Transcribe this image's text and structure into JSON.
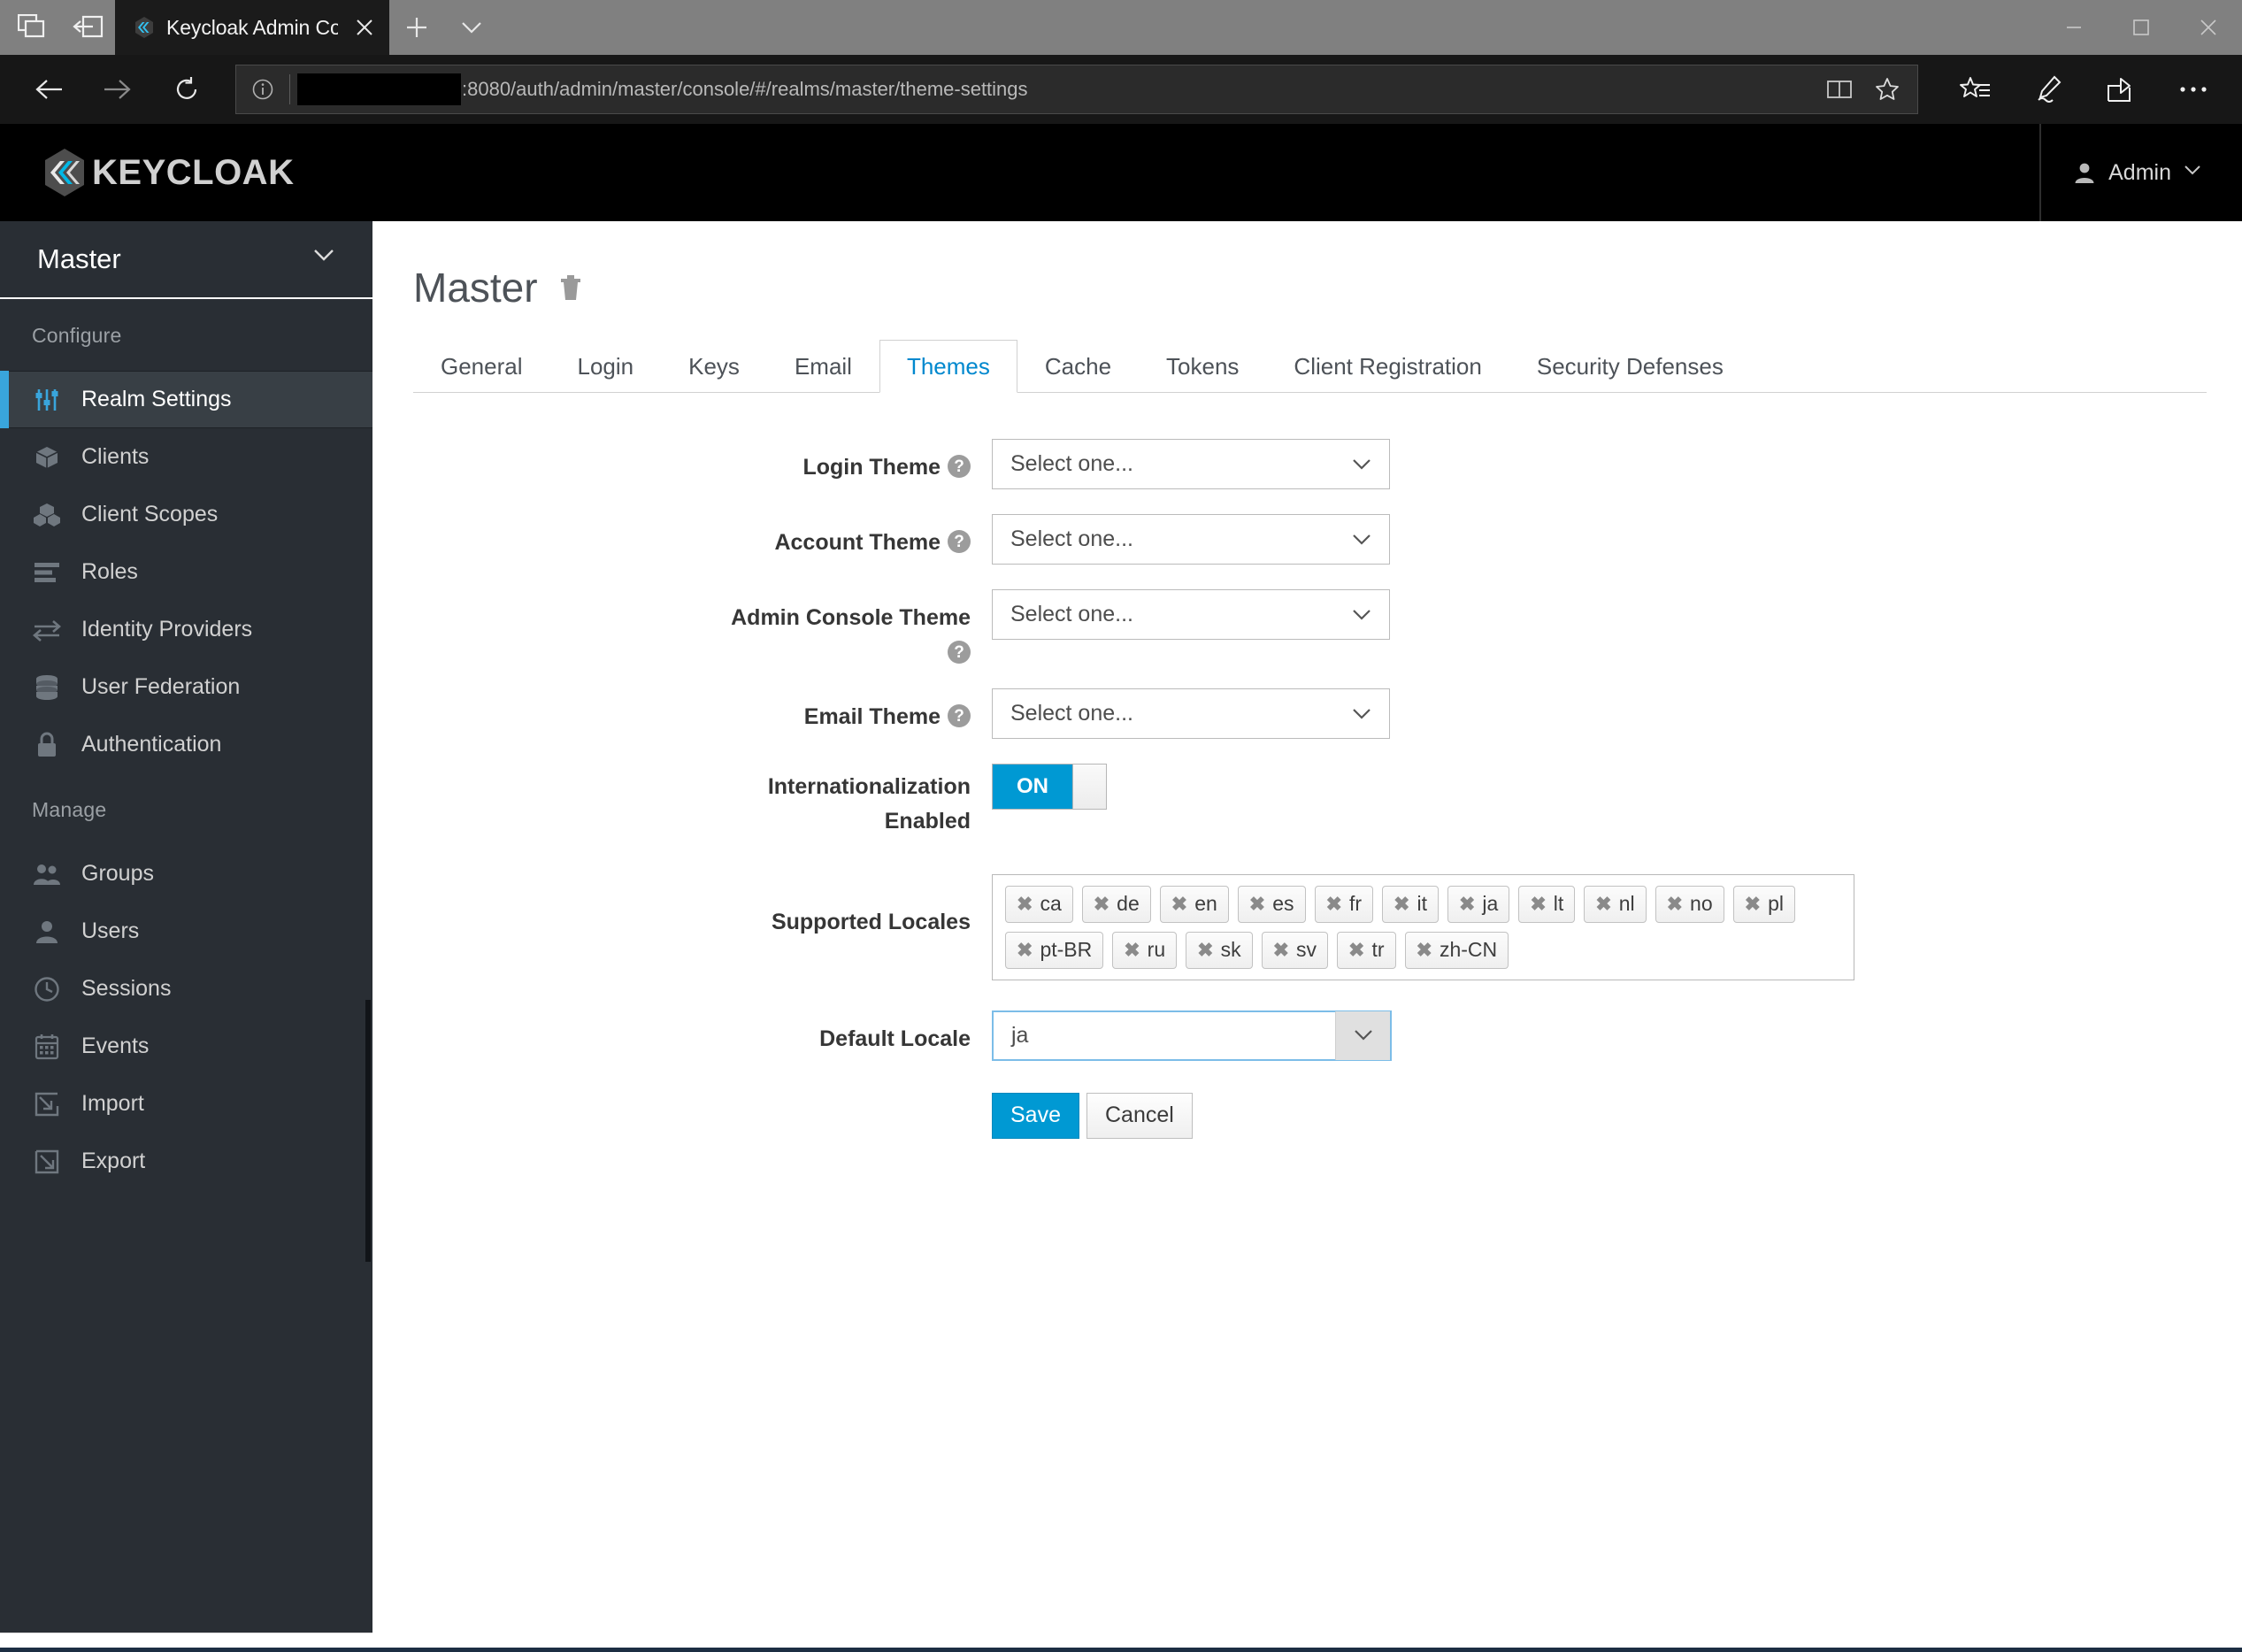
{
  "browser": {
    "tab": {
      "title": "Keycloak Admin Consol",
      "favicon_name": "keycloak-favicon",
      "close_label": "✕"
    },
    "toolbar_icons": {
      "tab_preview": "tab-preview-icon",
      "set_aside_tabs": "set-aside-tabs-icon",
      "new_tab": "+",
      "tab_menu": "chevron-down-icon",
      "back": "back-arrow-icon",
      "forward": "forward-arrow-icon",
      "refresh": "refresh-icon"
    },
    "window_controls": {
      "minimize": "—",
      "maximize": "☐",
      "close": "✕"
    },
    "url": {
      "info_icon": "info-icon",
      "host_redacted": true,
      "text": ":8080/auth/admin/master/console/#/realms/master/theme-settings",
      "reading_view_icon": "reading-view-icon",
      "favorite_icon": "star-icon"
    },
    "nav_right_icons": {
      "hub": "favorites-hub-icon",
      "web_note": "web-note-pen-icon",
      "share": "share-icon",
      "more": "···"
    }
  },
  "header": {
    "brand": "KEYCLOAK",
    "user": {
      "name": "Admin",
      "avatar_icon": "user-icon",
      "caret_icon": "chevron-down-icon"
    }
  },
  "sidebar": {
    "realm": {
      "name": "Master",
      "caret_icon": "chevron-down-icon"
    },
    "sections": [
      {
        "title": "Configure",
        "items": [
          {
            "label": "Realm Settings",
            "icon": "sliders-icon",
            "active": true
          },
          {
            "label": "Clients",
            "icon": "cube-icon",
            "active": false
          },
          {
            "label": "Client Scopes",
            "icon": "cubes-icon",
            "active": false
          },
          {
            "label": "Roles",
            "icon": "list-bars-icon",
            "active": false
          },
          {
            "label": "Identity Providers",
            "icon": "exchange-arrows-icon",
            "active": false
          },
          {
            "label": "User Federation",
            "icon": "database-icon",
            "active": false
          },
          {
            "label": "Authentication",
            "icon": "lock-icon",
            "active": false
          }
        ]
      },
      {
        "title": "Manage",
        "items": [
          {
            "label": "Groups",
            "icon": "users-group-icon",
            "active": false
          },
          {
            "label": "Users",
            "icon": "user-icon",
            "active": false
          },
          {
            "label": "Sessions",
            "icon": "clock-icon",
            "active": false
          },
          {
            "label": "Events",
            "icon": "calendar-icon",
            "active": false
          },
          {
            "label": "Import",
            "icon": "import-arrow-icon",
            "active": false
          },
          {
            "label": "Export",
            "icon": "export-arrow-icon",
            "active": false
          }
        ]
      }
    ]
  },
  "page": {
    "title": "Master",
    "delete_icon": "trash-icon",
    "tabs": [
      {
        "label": "General",
        "active": false
      },
      {
        "label": "Login",
        "active": false
      },
      {
        "label": "Keys",
        "active": false
      },
      {
        "label": "Email",
        "active": false
      },
      {
        "label": "Themes",
        "active": true
      },
      {
        "label": "Cache",
        "active": false
      },
      {
        "label": "Tokens",
        "active": false
      },
      {
        "label": "Client Registration",
        "active": false
      },
      {
        "label": "Security Defenses",
        "active": false
      }
    ]
  },
  "form": {
    "login_theme": {
      "label": "Login Theme",
      "help_icon": "question-mark-icon",
      "value": "Select one...",
      "caret_icon": "chevron-down-icon"
    },
    "account_theme": {
      "label": "Account Theme",
      "help_icon": "question-mark-icon",
      "value": "Select one...",
      "caret_icon": "chevron-down-icon"
    },
    "admin_console_theme": {
      "label": "Admin Console Theme",
      "help_icon": "question-mark-icon",
      "value": "Select one...",
      "caret_icon": "chevron-down-icon"
    },
    "email_theme": {
      "label": "Email Theme",
      "help_icon": "question-mark-icon",
      "value": "Select one...",
      "caret_icon": "chevron-down-icon"
    },
    "internationalization": {
      "label_line1": "Internationalization",
      "label_line2": "Enabled",
      "state": "ON"
    },
    "supported_locales": {
      "label": "Supported Locales",
      "remove_glyph": "✖",
      "tags": [
        "ca",
        "de",
        "en",
        "es",
        "fr",
        "it",
        "ja",
        "lt",
        "nl",
        "no",
        "pl",
        "pt-BR",
        "ru",
        "sk",
        "sv",
        "tr",
        "zh-CN"
      ]
    },
    "default_locale": {
      "label": "Default Locale",
      "value": "ja",
      "caret_icon": "chevron-down-icon"
    },
    "buttons": {
      "save": "Save",
      "cancel": "Cancel"
    }
  },
  "colors": {
    "accent_blue": "#0099d3",
    "link_blue": "#0088ce",
    "sidebar_bg": "#292e34",
    "sidebar_active_bg": "#383f45",
    "sidebar_active_marker": "#39a5dc",
    "header_bg": "#000000",
    "title_gray": "#4d5258"
  }
}
